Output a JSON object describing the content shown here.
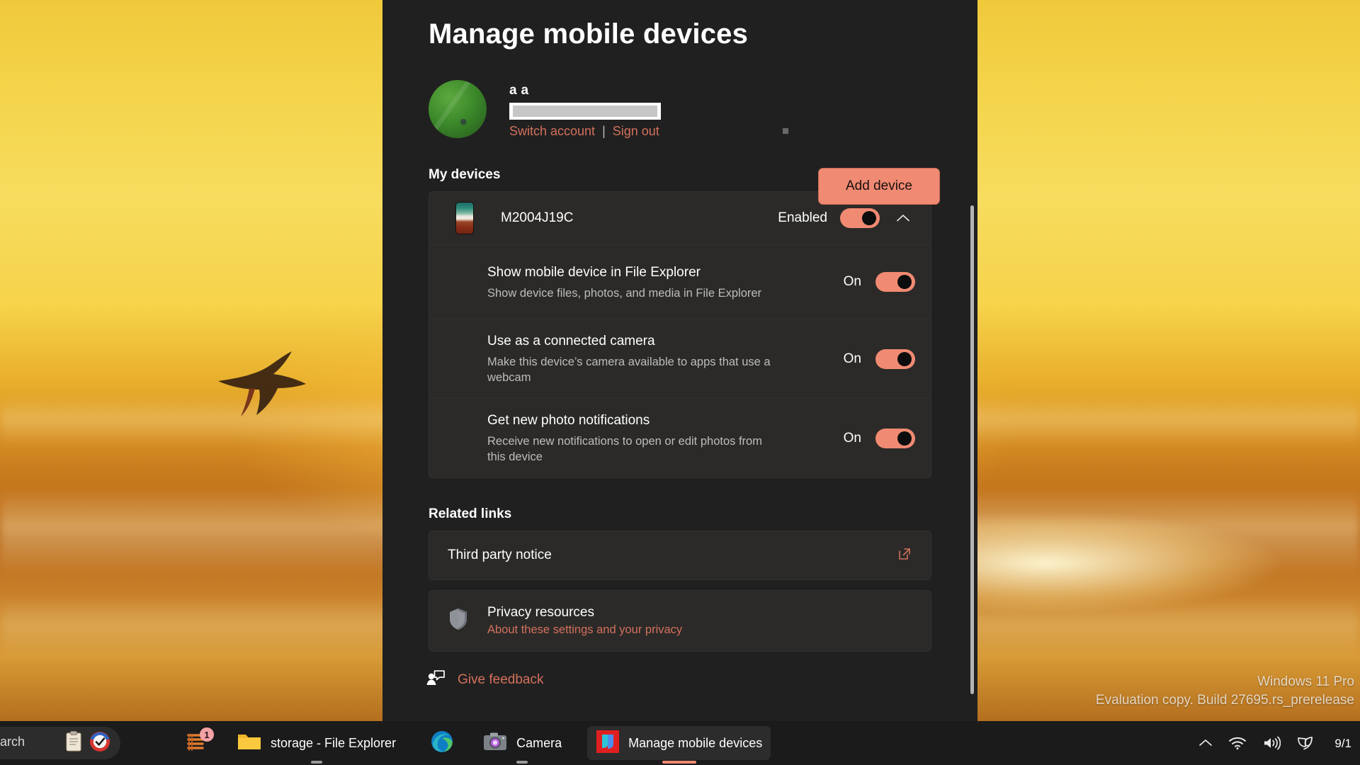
{
  "window": {
    "title": "Manage mobile devices"
  },
  "account": {
    "name": "a a",
    "email_redacted": "",
    "switch_account_label": "Switch account",
    "separator": "|",
    "sign_out_label": "Sign out",
    "add_device_label": "Add device",
    "avatar_alt": "avatar"
  },
  "my_devices": {
    "heading": "My devices",
    "device": {
      "name": "M2004J19C",
      "state_label": "Enabled",
      "toggle_on": true,
      "expanded": true
    },
    "settings": [
      {
        "title": "Show mobile device in File Explorer",
        "description": "Show device files, photos, and media in File Explorer",
        "state_label": "On",
        "toggle_on": true
      },
      {
        "title": "Use as a connected camera",
        "description": "Make this device’s camera available to apps that use a webcam",
        "state_label": "On",
        "toggle_on": true
      },
      {
        "title": "Get new photo notifications",
        "description": "Receive new notifications to open or edit photos from this device",
        "state_label": "On",
        "toggle_on": true
      }
    ]
  },
  "related_links": {
    "heading": "Related links",
    "third_party": {
      "title": "Third party notice"
    },
    "privacy": {
      "title": "Privacy resources",
      "subtitle": "About these settings and your privacy"
    }
  },
  "feedback": {
    "label": "Give feedback"
  },
  "watermark": {
    "line1": "Windows 11 Pro",
    "line2": "Evaluation copy. Build 27695.rs_prerelease"
  },
  "taskbar": {
    "search_label": "arch",
    "items": [
      {
        "label": "storage - File Explorer",
        "icon": "folder-icon",
        "active": false,
        "running": true
      },
      {
        "label": "Camera",
        "icon": "camera-icon",
        "active": false,
        "running": true
      },
      {
        "label": "Manage mobile devices",
        "icon": "phone-link-icon",
        "active": true,
        "running": true
      }
    ],
    "notifications_badge": "1",
    "clock": {
      "time": "9/1"
    }
  },
  "colors": {
    "accent": "#f08a72",
    "link": "#d3705c",
    "window_bg": "#202020",
    "card_bg": "#2b2a28",
    "taskbar_bg": "#1b1b1b"
  }
}
